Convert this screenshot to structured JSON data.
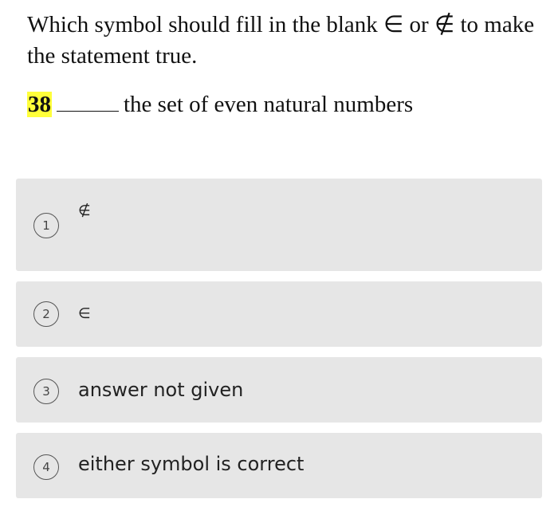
{
  "question": {
    "prompt": "Which symbol should fill in the blank ∈ or ∉ to make the statement true.",
    "number": "38",
    "statement_rest": "the set of even natural numbers"
  },
  "options": [
    {
      "index": "1",
      "label": "∉"
    },
    {
      "index": "2",
      "label": "∈"
    },
    {
      "index": "3",
      "label": "answer not given"
    },
    {
      "index": "4",
      "label": "either symbol is correct"
    }
  ],
  "colors": {
    "highlight": "#ffff3a",
    "option_bg": "#e6e6e6"
  }
}
